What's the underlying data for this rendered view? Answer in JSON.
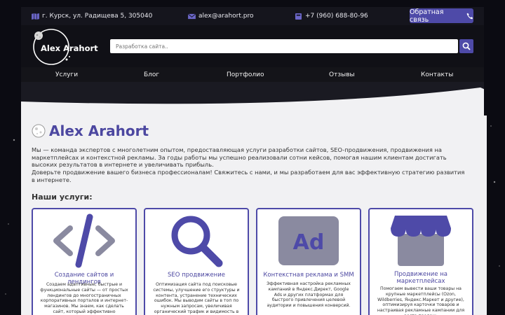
{
  "topbar": {
    "address": "г. Курск, ул. Радищева 5, 305040",
    "email": "alex@arahort.pro",
    "phone": "+7 (960) 688-80-96",
    "callback_label": "Обратная связь"
  },
  "header": {
    "logo_text": "Alex Arahort",
    "search_placeholder": "Разработка сайта.."
  },
  "nav": {
    "items": [
      "Услуги",
      "Блог",
      "Портфолио",
      "Отзывы",
      "Контакты"
    ]
  },
  "main": {
    "title": "Alex Arahort",
    "intro": "Мы — команда экспертов с многолетним опытом, предоставляющая услуги разработки сайтов, SEO-продвижения, продвижения на маркетплейсах и контекстной рекламы. За годы работы мы успешно реализовали сотни кейсов, помогая нашим клиентам достигать высоких результатов в интернете и увеличивать прибыль.",
    "cta": "Доверьте продвижение вашего бизнеса профессионалам! Свяжитесь с нами, и мы разработаем для вас эффективную стратегию развития в интернете.",
    "services_title": "Наши услуги:",
    "services": [
      {
        "icon": "code-icon",
        "title": "Создание сайтов и лендингов",
        "desc": "Создаем адаптивные, быстрые и функциональные сайты — от простых лендингов до многостраничных корпоративных порталов и интернет-магазинов. Мы знаем, как сделать сайт, который эффективно привлекает клиентов и соответствует бизнес-целям."
      },
      {
        "icon": "magnifier-icon",
        "title": "SEO продвижение",
        "desc": "Оптимизация сайта под поисковые системы, улучшение его структуры и контента, устранение технических ошибок. Мы выводим сайты в топ по нужным запросам, увеличивая органический трафик и видимость в интернете."
      },
      {
        "icon": "ad-icon",
        "title": "Контекстная реклама и SMM",
        "desc": "Эффективная настройка рекламных кампаний в Яндекс.Директ, Google Ads и других платформах для быстрого привлечения целевой аудитории и повышения конверсий."
      },
      {
        "icon": "storefront-icon",
        "title": "Продвижение на маркетплейсах",
        "desc": "Помогаем вывести ваши товары на крупные маркетплейсы (Ozon, Wildberries, Яндекс.Маркет и другие), оптимизируя карточки товаров и настраивая рекламные кампании для роста продаж."
      }
    ]
  },
  "colors": {
    "accent": "#4e4aa8",
    "icon_gray": "#8a8aa0"
  }
}
